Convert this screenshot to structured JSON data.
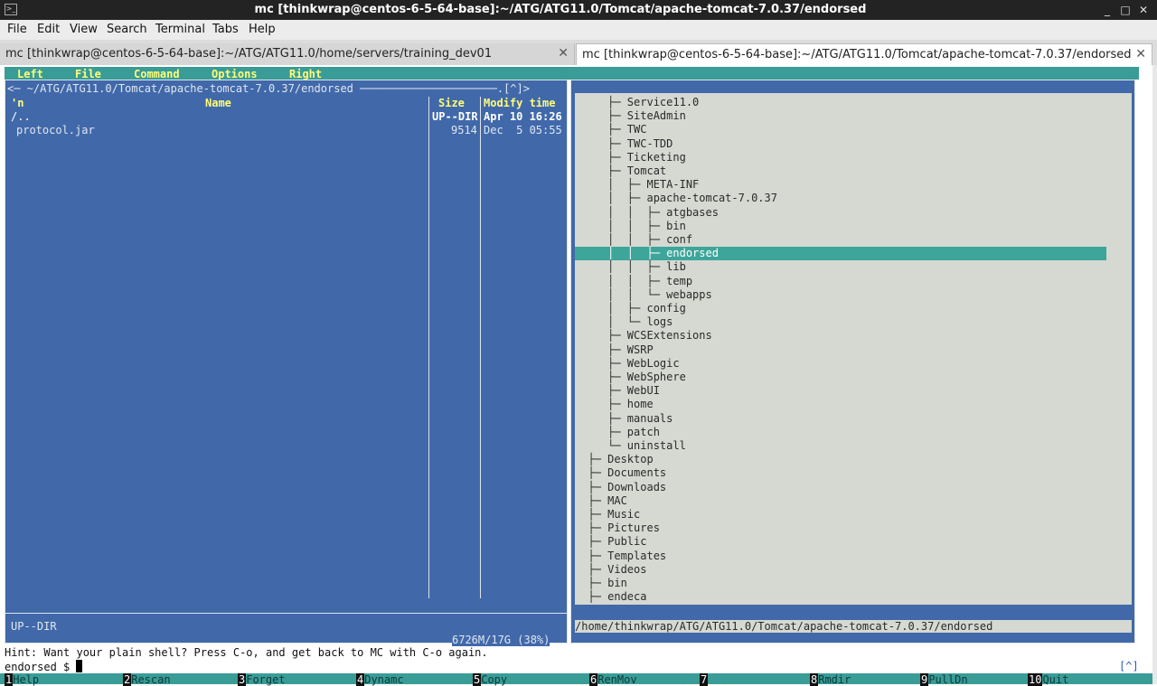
{
  "window": {
    "title": "mc [thinkwrap@centos-6-5-64-base]:~/ATG/ATG11.0/Tomcat/apache-tomcat-7.0.37/endorsed",
    "controls": [
      "_",
      "□",
      "✕"
    ]
  },
  "menubar": [
    "File",
    "Edit",
    "View",
    "Search",
    "Terminal",
    "Tabs",
    "Help"
  ],
  "tabs": [
    {
      "label": "mc [thinkwrap@centos-6-5-64-base]:~/ATG/ATG11.0/home/servers/training_dev01",
      "close": "✕"
    },
    {
      "label": "mc [thinkwrap@centos-6-5-64-base]:~/ATG/ATG11.0/Tomcat/apache-tomcat-7.0.37/endorsed",
      "close": "✕"
    }
  ],
  "mc_menu": [
    "Left",
    "File",
    "Command",
    "Options",
    "Right"
  ],
  "left_panel": {
    "path": "<─ ~/ATG/ATG11.0/Tomcat/apache-tomcat-7.0.37/endorsed ─────────────────────.[^]>",
    "sort_marker": "'n",
    "col_name": "Name",
    "col_size": "Size",
    "col_mtime": "Modify time",
    "rows": [
      {
        "name": "/..",
        "size": "UP--DIR",
        "mtime": "Apr 10 16:26"
      },
      {
        "name": "protocol.jar",
        "size": "9514",
        "mtime": "Dec  5 05:55"
      }
    ],
    "status": "UP--DIR",
    "free": "6726M/17G (38%)"
  },
  "right_panel": {
    "tree": [
      "     ├─ Service11.0",
      "     ├─ SiteAdmin",
      "     ├─ TWC",
      "     ├─ TWC-TDD",
      "     ├─ Ticketing",
      "     ├─ Tomcat",
      "     │  ├─ META-INF",
      "     │  ├─ apache-tomcat-7.0.37",
      "     │  │  ├─ atgbases",
      "     │  │  ├─ bin",
      "     │  │  ├─ conf",
      "     │  │  ├─ endorsed",
      "     │  │  ├─ lib",
      "     │  │  ├─ temp",
      "     │  │  └─ webapps",
      "     │  ├─ config",
      "     │  └─ logs",
      "     ├─ WCSExtensions",
      "     ├─ WSRP",
      "     ├─ WebLogic",
      "     ├─ WebSphere",
      "     ├─ WebUI",
      "     ├─ home",
      "     ├─ manuals",
      "     ├─ patch",
      "     └─ uninstall",
      "  ├─ Desktop",
      "  ├─ Documents",
      "  ├─ Downloads",
      "  ├─ MAC",
      "  ├─ Music",
      "  ├─ Pictures",
      "  ├─ Public",
      "  ├─ Templates",
      "  ├─ Videos",
      "  ├─ bin",
      "  ├─ endeca"
    ],
    "selected_index": 11,
    "path": "/home/thinkwrap/ATG/ATG11.0/Tomcat/apache-tomcat-7.0.37/endorsed"
  },
  "hint": "Hint: Want your plain shell? Press C-o, and get back to MC with C-o again.",
  "prompt": "endorsed $ ",
  "scroll_indicator": "[^]",
  "fkeys": [
    {
      "num": "1",
      "label": "Help"
    },
    {
      "num": "2",
      "label": "Rescan"
    },
    {
      "num": "3",
      "label": "Forget"
    },
    {
      "num": "4",
      "label": "Dynamc"
    },
    {
      "num": "5",
      "label": "Copy"
    },
    {
      "num": "6",
      "label": "RenMov"
    },
    {
      "num": "7",
      "label": ""
    },
    {
      "num": "8",
      "label": "Rmdir"
    },
    {
      "num": "9",
      "label": "PullDn"
    },
    {
      "num": "10",
      "label": "Quit"
    }
  ]
}
